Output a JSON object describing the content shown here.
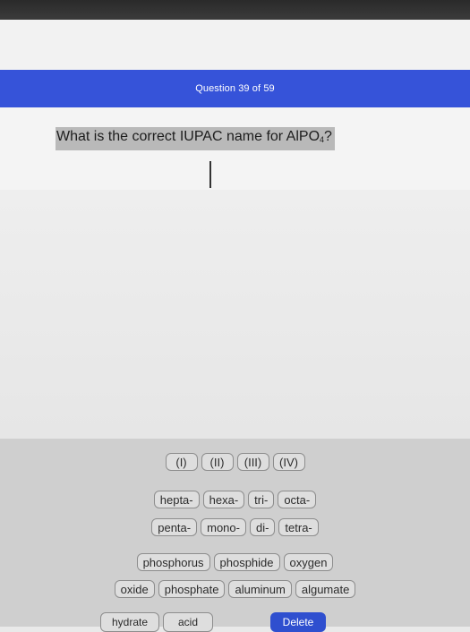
{
  "header": {
    "question_counter": "Question 39 of 59"
  },
  "question": {
    "text": "What is the correct IUPAC name for AlPO",
    "subscript": "4",
    "suffix": "?"
  },
  "keyboard": {
    "roman_numerals": [
      "(I)",
      "(II)",
      "(III)",
      "(IV)"
    ],
    "prefix_row_1": [
      "hepta-",
      "hexa-",
      "tri-",
      "octa-"
    ],
    "prefix_row_2": [
      "penta-",
      "mono-",
      "di-",
      "tetra-"
    ],
    "word_row_1": [
      "phosphorus",
      "phosphide",
      "oxygen"
    ],
    "word_row_2": [
      "oxide",
      "phosphate",
      "aluminum",
      "algumate"
    ],
    "word_row_3": [
      "hydrate",
      "acid"
    ],
    "delete_label": "Delete"
  },
  "colors": {
    "header_bg": "#3653d9",
    "delete_bg": "#2f4fcf"
  }
}
